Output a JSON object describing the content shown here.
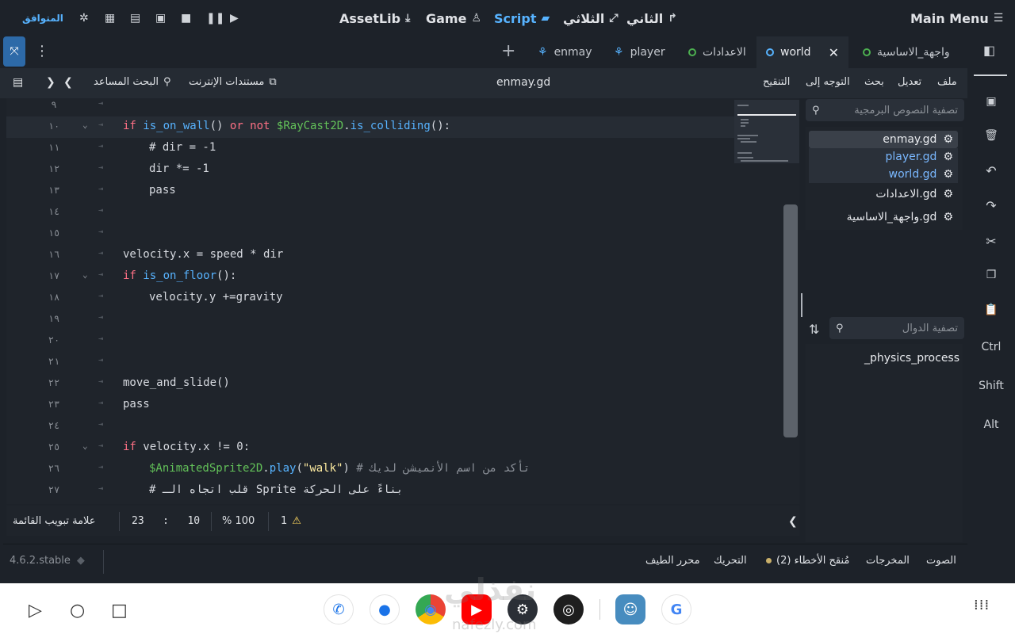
{
  "topbar": {
    "main_menu": "Main Menu",
    "tabs": [
      "الثاني",
      "الثلاثي",
      "Script",
      "Game",
      "AssetLib"
    ],
    "compat": "المتوافق"
  },
  "doc_tabs": {
    "items": [
      "واجهة_الاساسية",
      "world",
      "الاعدادات",
      "player",
      "enmay"
    ],
    "active": "world"
  },
  "toolbar2": {
    "menus": [
      "ملف",
      "تعديل",
      "بحث",
      "التوجه إلى",
      "التنقيح"
    ],
    "file_name": "enmay.gd",
    "online_docs": "مستندات الإنترنت",
    "help_search": "البحث المساعد"
  },
  "editor": {
    "lines": [
      {
        "n": "٩",
        "code": ""
      },
      {
        "n": "١٠",
        "code": "if is_on_wall() or not $RayCast2D.is_colliding():"
      },
      {
        "n": "١١",
        "code": "# dir = -1"
      },
      {
        "n": "١٢",
        "code": "dir *= -1"
      },
      {
        "n": "١٣",
        "code": "pass"
      },
      {
        "n": "١٤",
        "code": ""
      },
      {
        "n": "١٥",
        "code": ""
      },
      {
        "n": "١٦",
        "code": "velocity.x = speed * dir"
      },
      {
        "n": "١٧",
        "code": "if is_on_floor():"
      },
      {
        "n": "١٨",
        "code": "velocity.y +=gravity"
      },
      {
        "n": "١٩",
        "code": ""
      },
      {
        "n": "٢٠",
        "code": ""
      },
      {
        "n": "٢١",
        "code": ""
      },
      {
        "n": "٢٢",
        "code": "move_and_slide()"
      },
      {
        "n": "٢٣",
        "code": "pass"
      },
      {
        "n": "٢٤",
        "code": ""
      },
      {
        "n": "٢٥",
        "code": "if velocity.x != 0:"
      },
      {
        "n": "٢٦",
        "code": "$AnimatedSprite2D.play(\"walk\") # تأكد من اسم الأنميشن لديك"
      },
      {
        "n": "٢٧",
        "code": "# قلب اتجاه الـ Sprite بناءً على الحركة"
      }
    ]
  },
  "status": {
    "warnings": "1",
    "zoom": "% 100",
    "position": "23   :   10",
    "indent_label": "علامة تبويب القائمة"
  },
  "side": {
    "filter_scripts": "تصفية النصوص البرمجية",
    "files": [
      "enmay.gd",
      "player.gd",
      "world.gd",
      "الاعدادات.gd",
      "واجهة_الاساسية.gd"
    ],
    "filter_methods": "تصفية الدوال",
    "methods": [
      "_physics_process"
    ]
  },
  "rightbar": {
    "keys": [
      "Ctrl",
      "Shift",
      "Alt"
    ]
  },
  "bottom": {
    "items": [
      "الصوت",
      "المخرجات",
      "مُنقح الأخطاء (2)",
      "التحريك",
      "محرر الطيف"
    ],
    "version": "4.6.2.stable"
  },
  "watermark": {
    "text": "نفذلي",
    "url": "nafezly.com"
  },
  "colors": {
    "keyword": "#ff7085",
    "function": "#57b3ff",
    "node": "#63c259",
    "string": "#ffeda1",
    "accent": "#57b3ff"
  }
}
